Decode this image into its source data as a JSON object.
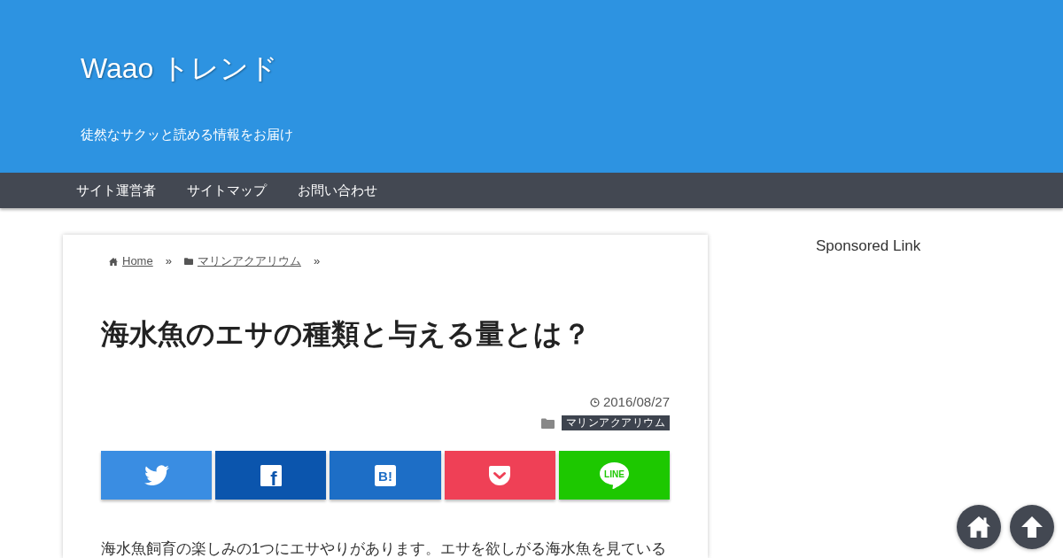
{
  "header": {
    "site_title": "Waao トレンド",
    "tagline": "徒然なサクッと読める情報をお届け"
  },
  "nav": {
    "items": [
      "サイト運営者",
      "サイトマップ",
      "お問い合わせ"
    ]
  },
  "breadcrumb": [
    {
      "kind": "home",
      "label": "Home",
      "separator": "»"
    },
    {
      "kind": "category",
      "label": "マリンアクアリウム",
      "separator": "»"
    }
  ],
  "article": {
    "title": "海水魚のエサの種類と与える量とは？",
    "date": "2016/08/27",
    "category": "マリンアクアリウム",
    "share_buttons": [
      {
        "kind": "twitter"
      },
      {
        "kind": "facebook",
        "glyph": "f"
      },
      {
        "kind": "hatena",
        "glyph": "B!"
      },
      {
        "kind": "pocket"
      },
      {
        "kind": "line",
        "glyph": "LINE"
      }
    ],
    "body": "海水魚飼育の楽しみの1つにエサやりがあります。エサを欲しがる海水魚を見ている"
  },
  "sidebar": {
    "heading": "Sponsored Link"
  },
  "floating_buttons": [
    {
      "kind": "home"
    },
    {
      "kind": "top"
    }
  ]
}
